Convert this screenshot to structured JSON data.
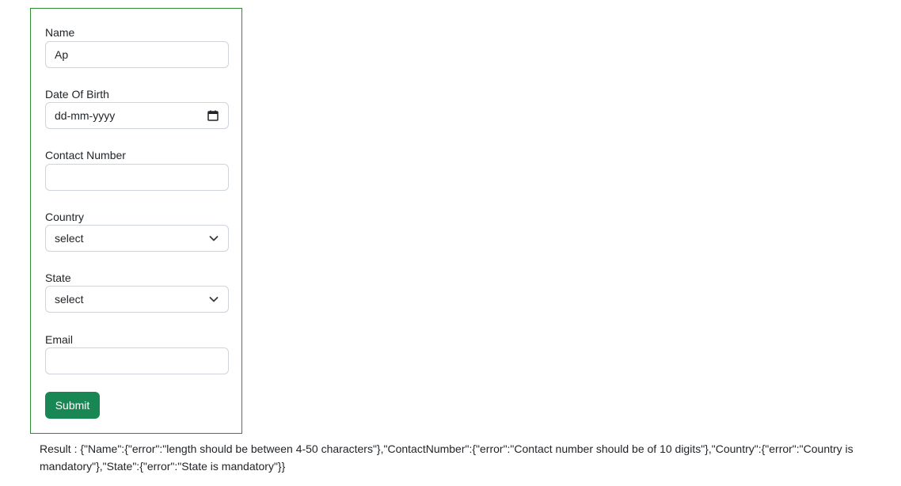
{
  "form": {
    "name": {
      "label": "Name",
      "value": "Ap"
    },
    "dob": {
      "label": "Date Of Birth",
      "placeholder": "dd-mm-yyyy"
    },
    "contact": {
      "label": "Contact Number",
      "value": ""
    },
    "country": {
      "label": "Country",
      "selected": "select"
    },
    "state": {
      "label": "State",
      "selected": "select"
    },
    "email": {
      "label": "Email",
      "value": ""
    },
    "submit_label": "Submit"
  },
  "result": {
    "text": "Result : {\"Name\":{\"error\":\"length should be between 4-50 characters\"},\"ContactNumber\":{\"error\":\"Contact number should be of 10 digits\"},\"Country\":{\"error\":\"Country is mandatory\"},\"State\":{\"error\":\"State is mandatory\"}}"
  },
  "colors": {
    "card_border": "#2e8b2e",
    "submit_bg": "#198754",
    "input_border": "#ced4da"
  },
  "icons": {
    "dob": "calendar-icon",
    "country": "chevron-down-icon",
    "state": "chevron-down-icon"
  }
}
